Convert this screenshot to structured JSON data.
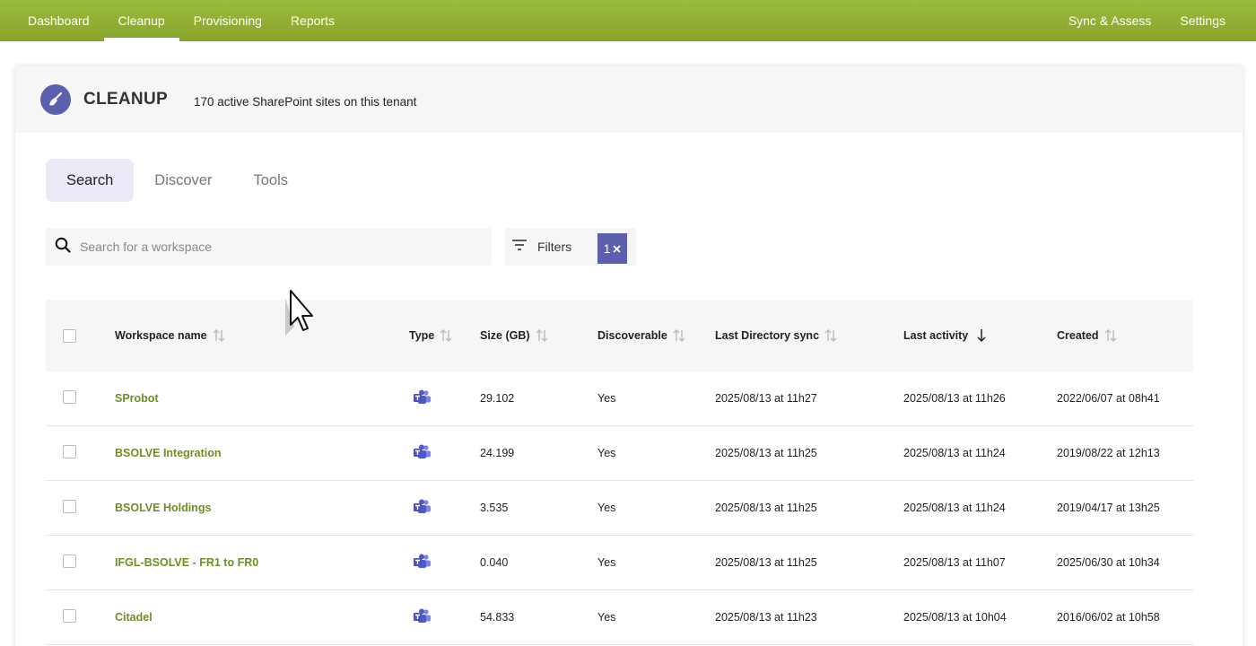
{
  "nav": {
    "left": [
      "Dashboard",
      "Cleanup",
      "Provisioning",
      "Reports"
    ],
    "right": [
      "Sync & Assess",
      "Settings"
    ],
    "active": "Cleanup"
  },
  "header": {
    "title": "CLEANUP",
    "subtitle": "170 active SharePoint sites on this tenant"
  },
  "tabs": [
    "Search",
    "Discover",
    "Tools"
  ],
  "search": {
    "placeholder": "Search for a workspace"
  },
  "filters": {
    "label": "Filters",
    "count": "1"
  },
  "table": {
    "columns": [
      "Workspace name",
      "Type",
      "Size (GB)",
      "Discoverable",
      "Last Directory sync",
      "Last activity",
      "Created"
    ],
    "rows": [
      {
        "name": "SProbot",
        "type": "teams-icon",
        "size": "29.102",
        "discoverable": "Yes",
        "sync": "2025/08/13 at 11h27",
        "activity": "2025/08/13 at 11h26",
        "created": "2022/06/07 at 08h41"
      },
      {
        "name": "BSOLVE Integration",
        "type": "teams-icon",
        "size": "24.199",
        "discoverable": "Yes",
        "sync": "2025/08/13 at 11h25",
        "activity": "2025/08/13 at 11h24",
        "created": "2019/08/22 at 12h13"
      },
      {
        "name": "BSOLVE Holdings",
        "type": "teams-icon",
        "size": "3.535",
        "discoverable": "Yes",
        "sync": "2025/08/13 at 11h25",
        "activity": "2025/08/13 at 11h24",
        "created": "2019/04/17 at 13h25"
      },
      {
        "name": "IFGL-BSOLVE - FR1 to FR0",
        "type": "teams-icon",
        "size": "0.040",
        "discoverable": "Yes",
        "sync": "2025/08/13 at 11h25",
        "activity": "2025/08/13 at 11h07",
        "created": "2025/06/30 at 10h34"
      },
      {
        "name": "Citadel",
        "type": "teams-icon",
        "size": "54.833",
        "discoverable": "Yes",
        "sync": "2025/08/13 at 11h23",
        "activity": "2025/08/13 at 10h04",
        "created": "2016/06/02 at 10h58"
      }
    ]
  },
  "colors": {
    "nav": "#8fb034",
    "accent": "#5b5fae",
    "link": "#6e8f24"
  }
}
